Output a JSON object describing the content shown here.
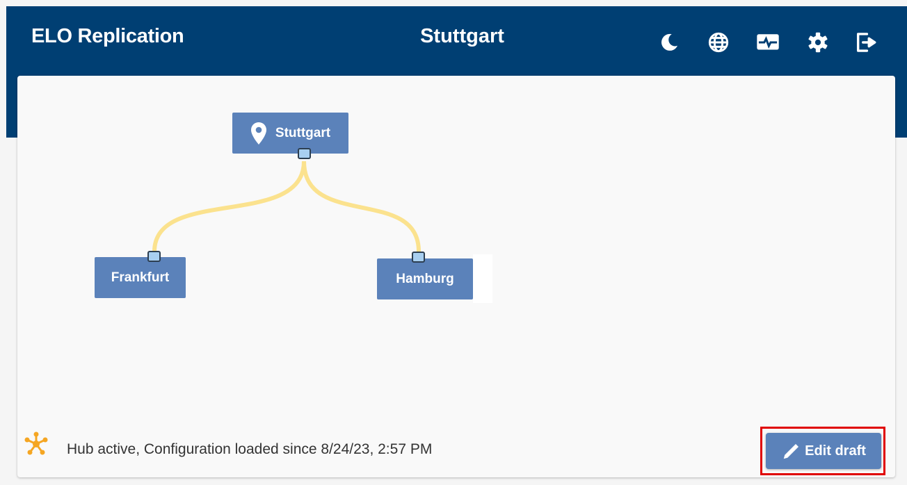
{
  "header": {
    "app_title": "ELO Replication",
    "location_title": "Stuttgart",
    "icons": [
      "moon-icon",
      "globe-icon",
      "monitor-icon",
      "gear-icon",
      "logout-icon"
    ]
  },
  "graph": {
    "nodes": [
      {
        "id": "stuttgart",
        "label": "Stuttgart",
        "icon": "location-pin-icon",
        "role": "hub"
      },
      {
        "id": "frankfurt",
        "label": "Frankfurt"
      },
      {
        "id": "hamburg",
        "label": "Hamburg"
      }
    ],
    "edges": [
      {
        "from": "stuttgart",
        "to": "frankfurt"
      },
      {
        "from": "stuttgart",
        "to": "hamburg"
      }
    ]
  },
  "status": {
    "icon": "hub-icon",
    "text": "Hub active, Configuration loaded since 8/24/23, 2:57 PM"
  },
  "actions": {
    "edit_draft_label": "Edit draft"
  },
  "colors": {
    "header_bg": "#003f73",
    "node_bg": "#5b82ba",
    "edge": "#fbe28e",
    "hub_icon": "#f5a623",
    "highlight": "#e00000"
  }
}
